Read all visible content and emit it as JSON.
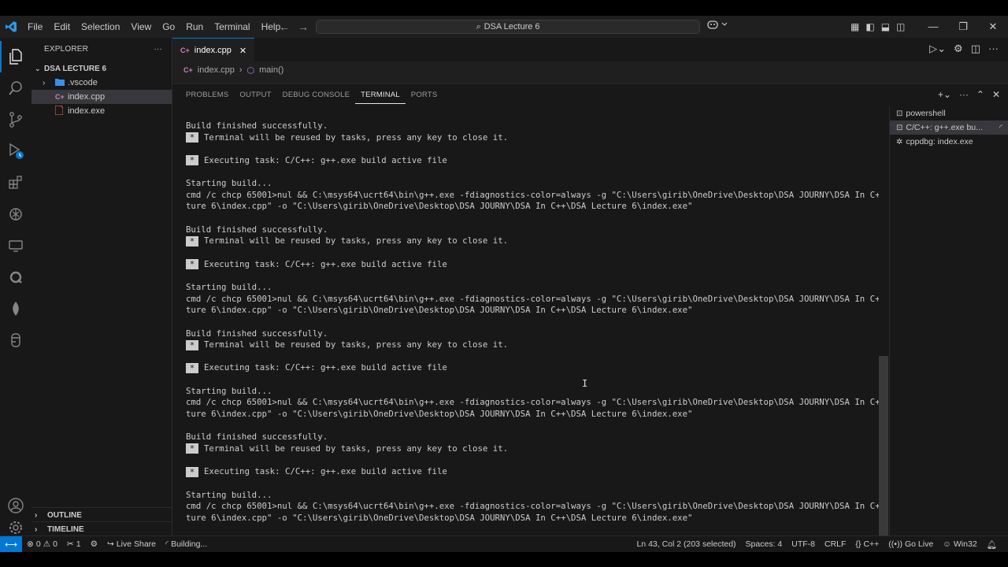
{
  "menu": [
    "File",
    "Edit",
    "Selection",
    "View",
    "Go",
    "Run",
    "Terminal",
    "Help"
  ],
  "command_center": "DSA Lecture 6",
  "explorer": {
    "title": "EXPLORER",
    "folder": "DSA LECTURE 6",
    "items": [
      {
        "label": ".vscode",
        "icon": "folder-icon"
      },
      {
        "label": "index.cpp",
        "icon": "cpp-file-icon"
      },
      {
        "label": "index.exe",
        "icon": "exe-file-icon"
      }
    ],
    "outline": "OUTLINE",
    "timeline": "TIMELINE"
  },
  "tab": {
    "label": "index.cpp"
  },
  "breadcrumb": {
    "file": "index.cpp",
    "symbol": "main()"
  },
  "panel_tabs": [
    "PROBLEMS",
    "OUTPUT",
    "DEBUG CONSOLE",
    "TERMINAL",
    "PORTS"
  ],
  "active_panel_tab": "TERMINAL",
  "terminal_lines": [
    {
      "text": "Build finished successfully."
    },
    {
      "star": "*",
      "text": "Terminal will be reused by tasks, press any key to close it."
    },
    {
      "text": ""
    },
    {
      "star": "*",
      "text": "Executing task: C/C++: g++.exe build active file"
    },
    {
      "text": ""
    },
    {
      "text": "Starting build..."
    },
    {
      "text": "cmd /c chcp 65001>nul && C:\\msys64\\ucrt64\\bin\\g++.exe -fdiagnostics-color=always -g \"C:\\Users\\girib\\OneDrive\\Desktop\\DSA JOURNY\\DSA In C++\\DSA Lec"
    },
    {
      "text": "ture 6\\index.cpp\" -o \"C:\\Users\\girib\\OneDrive\\Desktop\\DSA JOURNY\\DSA In C++\\DSA Lecture 6\\index.exe\""
    },
    {
      "text": ""
    },
    {
      "text": "Build finished successfully."
    },
    {
      "star": "*",
      "text": "Terminal will be reused by tasks, press any key to close it."
    },
    {
      "text": ""
    },
    {
      "star": "*",
      "text": "Executing task: C/C++: g++.exe build active file"
    },
    {
      "text": ""
    },
    {
      "text": "Starting build..."
    },
    {
      "text": "cmd /c chcp 65001>nul && C:\\msys64\\ucrt64\\bin\\g++.exe -fdiagnostics-color=always -g \"C:\\Users\\girib\\OneDrive\\Desktop\\DSA JOURNY\\DSA In C++\\DSA Lec"
    },
    {
      "text": "ture 6\\index.cpp\" -o \"C:\\Users\\girib\\OneDrive\\Desktop\\DSA JOURNY\\DSA In C++\\DSA Lecture 6\\index.exe\""
    },
    {
      "text": ""
    },
    {
      "text": "Build finished successfully."
    },
    {
      "star": "*",
      "text": "Terminal will be reused by tasks, press any key to close it."
    },
    {
      "text": ""
    },
    {
      "star": "*",
      "text": "Executing task: C/C++: g++.exe build active file"
    },
    {
      "text": ""
    },
    {
      "text": "Starting build..."
    },
    {
      "text": "cmd /c chcp 65001>nul && C:\\msys64\\ucrt64\\bin\\g++.exe -fdiagnostics-color=always -g \"C:\\Users\\girib\\OneDrive\\Desktop\\DSA JOURNY\\DSA In C++\\DSA Lec"
    },
    {
      "text": "ture 6\\index.cpp\" -o \"C:\\Users\\girib\\OneDrive\\Desktop\\DSA JOURNY\\DSA In C++\\DSA Lecture 6\\index.exe\""
    },
    {
      "text": ""
    },
    {
      "text": "Build finished successfully."
    },
    {
      "star": "*",
      "text": "Terminal will be reused by tasks, press any key to close it."
    },
    {
      "text": ""
    },
    {
      "star": "*",
      "text": "Executing task: C/C++: g++.exe build active file"
    },
    {
      "text": ""
    },
    {
      "text": "Starting build..."
    },
    {
      "text": "cmd /c chcp 65001>nul && C:\\msys64\\ucrt64\\bin\\g++.exe -fdiagnostics-color=always -g \"C:\\Users\\girib\\OneDrive\\Desktop\\DSA JOURNY\\DSA In C++\\DSA Lec"
    },
    {
      "text": "ture 6\\index.cpp\" -o \"C:\\Users\\girib\\OneDrive\\Desktop\\DSA JOURNY\\DSA In C++\\DSA Lecture 6\\index.exe\""
    }
  ],
  "terminal_list": [
    {
      "label": "powershell",
      "icon": "terminal-icon"
    },
    {
      "label": "C/C++: g++.exe bu...",
      "icon": "terminal-icon",
      "selected": true
    },
    {
      "label": "cppdbg: index.exe",
      "icon": "debug-icon"
    }
  ],
  "status": {
    "errors": "0",
    "warnings": "0",
    "ports": "1",
    "live_share": "Live Share",
    "building": "Building...",
    "position": "Ln 43, Col 2 (203 selected)",
    "spaces": "Spaces: 4",
    "encoding": "UTF-8",
    "eol": "CRLF",
    "language": "C++",
    "go_live": "Go Live",
    "platform": "Win32"
  },
  "colors": {
    "accent": "#0078d4",
    "background": "#1f1f1f",
    "sidebar": "#181818"
  }
}
